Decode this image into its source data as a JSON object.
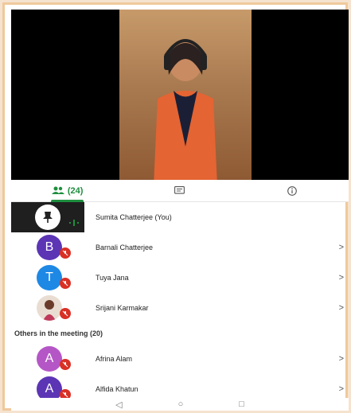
{
  "tabs": {
    "participants_count": "(24)",
    "chat_label": "",
    "info_label": ""
  },
  "participants": [
    {
      "name": "Sumita Chatterjee (You)",
      "initial": "",
      "color": "#ffffff",
      "muted": false,
      "self": true,
      "chevron": ""
    },
    {
      "name": "Barnali Chatterjee",
      "initial": "B",
      "color": "#5c35b5",
      "muted": true,
      "chevron": ">"
    },
    {
      "name": "Tuya Jana",
      "initial": "T",
      "color": "#1e88e5",
      "muted": true,
      "chevron": ">"
    },
    {
      "name": "Srijani Karmakar",
      "initial": "",
      "color": "#d7c6b8",
      "muted": true,
      "photo": true,
      "chevron": ">"
    }
  ],
  "others_section": {
    "title": "Others in the meeting (20)",
    "participants": [
      {
        "name": "Afrina Alam",
        "initial": "A",
        "color": "#b556c7",
        "muted": true,
        "chevron": ">"
      },
      {
        "name": "Alfida Khatun",
        "initial": "A",
        "color": "#5c35b5",
        "muted": true,
        "chevron": ">"
      }
    ]
  },
  "navbar": {
    "back": "◁",
    "home": "○",
    "recents": "□"
  },
  "colors": {
    "accent": "#1e8e3e",
    "mute_red": "#d93025"
  }
}
